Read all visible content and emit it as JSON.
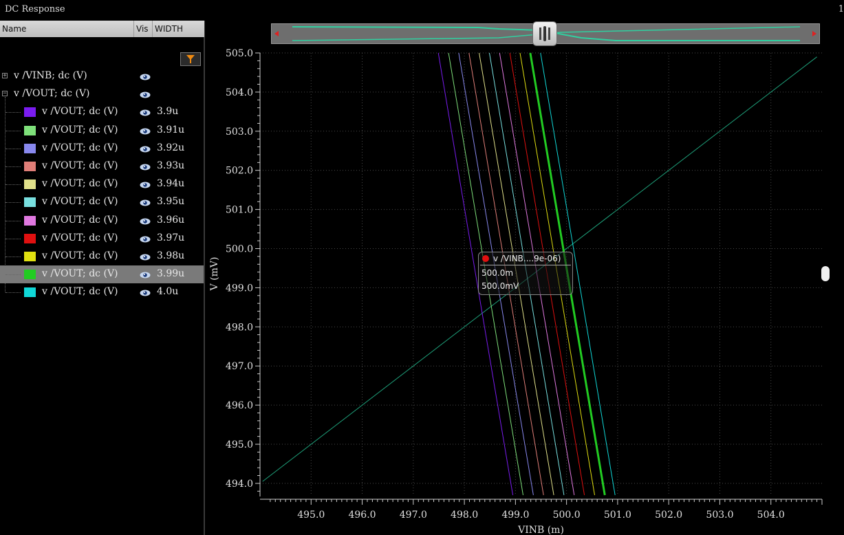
{
  "window": {
    "title": "DC Response",
    "corner_number": "1"
  },
  "panel": {
    "headers": {
      "name": "Name",
      "vis": "Vis",
      "width": "WIDTH"
    },
    "groups": [
      {
        "label": "v /VINB; dc (V)",
        "expanded": false
      },
      {
        "label": "v /VOUT; dc (V)",
        "expanded": true
      }
    ],
    "items": [
      {
        "label": "v /VOUT; dc (V)",
        "value": "3.9u",
        "color": "#7a1cf0"
      },
      {
        "label": "v /VOUT; dc (V)",
        "value": "3.91u",
        "color": "#7ee07a"
      },
      {
        "label": "v /VOUT; dc (V)",
        "value": "3.92u",
        "color": "#8888ee"
      },
      {
        "label": "v /VOUT; dc (V)",
        "value": "3.93u",
        "color": "#e07e78"
      },
      {
        "label": "v /VOUT; dc (V)",
        "value": "3.94u",
        "color": "#e0e08a"
      },
      {
        "label": "v /VOUT; dc (V)",
        "value": "3.95u",
        "color": "#78e0e0"
      },
      {
        "label": "v /VOUT; dc (V)",
        "value": "3.96u",
        "color": "#e078e0"
      },
      {
        "label": "v /VOUT; dc (V)",
        "value": "3.97u",
        "color": "#e01010"
      },
      {
        "label": "v /VOUT; dc (V)",
        "value": "3.98u",
        "color": "#e0e010"
      },
      {
        "label": "v /VOUT; dc (V)",
        "value": "3.99u",
        "color": "#22cc22",
        "selected": true
      },
      {
        "label": "v /VOUT; dc (V)",
        "value": "4.0u",
        "color": "#10d8d8"
      }
    ]
  },
  "marker": {
    "label": "v /VINB....9e-06)",
    "x_text": "500.0m",
    "y_text": "500.0mV"
  },
  "chart_data": {
    "type": "line",
    "xlabel": "VINB (m)",
    "ylabel": "V (mV)",
    "xlim": [
      494.0,
      505.0
    ],
    "ylim": [
      493.7,
      505.0
    ],
    "x_ticks": [
      "495.0",
      "496.0",
      "497.0",
      "498.0",
      "499.0",
      "500.0",
      "501.0",
      "502.0",
      "503.0",
      "504.0"
    ],
    "y_ticks": [
      "494.0",
      "495.0",
      "496.0",
      "497.0",
      "498.0",
      "499.0",
      "500.0",
      "501.0",
      "502.0",
      "503.0",
      "504.0",
      "505.0"
    ],
    "grid": true,
    "series": [
      {
        "name": "v /VINB; dc (V)",
        "color": "#1ea07a",
        "width": 1,
        "points": [
          [
            494.05,
            494.05
          ],
          [
            504.9,
            504.9
          ]
        ]
      },
      {
        "name": "3.9u",
        "color": "#7a1cf0",
        "width": 1,
        "points": [
          [
            497.49,
            505.0
          ],
          [
            498.95,
            493.7
          ]
        ]
      },
      {
        "name": "3.91u",
        "color": "#7ee07a",
        "width": 1,
        "points": [
          [
            497.69,
            505.0
          ],
          [
            499.15,
            493.7
          ]
        ]
      },
      {
        "name": "3.92u",
        "color": "#8888ee",
        "width": 1,
        "points": [
          [
            497.89,
            505.0
          ],
          [
            499.35,
            493.7
          ]
        ]
      },
      {
        "name": "3.93u",
        "color": "#e07e78",
        "width": 1,
        "points": [
          [
            498.09,
            505.0
          ],
          [
            499.55,
            493.7
          ]
        ]
      },
      {
        "name": "3.94u",
        "color": "#e0e08a",
        "width": 1,
        "points": [
          [
            498.29,
            505.0
          ],
          [
            499.75,
            493.7
          ]
        ]
      },
      {
        "name": "3.95u",
        "color": "#78e0e0",
        "width": 1,
        "points": [
          [
            498.49,
            505.0
          ],
          [
            499.95,
            493.7
          ]
        ]
      },
      {
        "name": "3.96u",
        "color": "#e078e0",
        "width": 1,
        "points": [
          [
            498.69,
            505.0
          ],
          [
            500.15,
            493.7
          ]
        ]
      },
      {
        "name": "3.97u",
        "color": "#e01010",
        "width": 1,
        "points": [
          [
            498.89,
            505.0
          ],
          [
            500.35,
            493.7
          ]
        ]
      },
      {
        "name": "3.98u",
        "color": "#e0e010",
        "width": 1,
        "points": [
          [
            499.09,
            505.0
          ],
          [
            500.55,
            493.7
          ]
        ]
      },
      {
        "name": "3.99u",
        "color": "#22cc22",
        "width": 3,
        "points": [
          [
            499.29,
            505.0
          ],
          [
            500.75,
            493.7
          ]
        ]
      },
      {
        "name": "4.0u",
        "color": "#10d8d8",
        "width": 1,
        "points": [
          [
            499.49,
            505.0
          ],
          [
            500.95,
            493.7
          ]
        ]
      }
    ]
  }
}
